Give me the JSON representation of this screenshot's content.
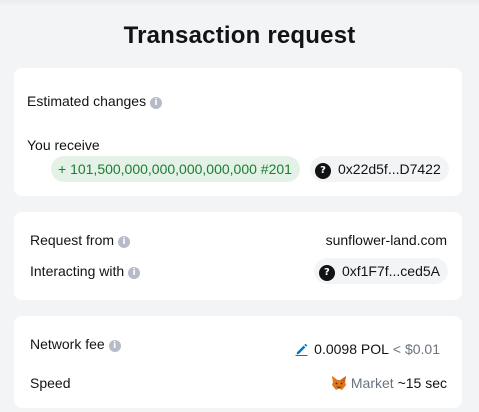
{
  "header": {
    "title": "Transaction request"
  },
  "estimated_changes": {
    "label": "Estimated changes",
    "you_receive_label": "You receive",
    "amount": "+ 101,500,000,000,000,000,000 #201",
    "contract_address": "0x22d5f...D7422"
  },
  "request": {
    "request_from_label": "Request from",
    "request_from_value": "sunflower-land.com",
    "interacting_with_label": "Interacting with",
    "interacting_with_value": "0xf1F7f...ced5A"
  },
  "network": {
    "fee_label": "Network fee",
    "fee_value": "0.0098 POL",
    "fee_fiat": "< $0.01",
    "speed_label": "Speed",
    "speed_value": "Market",
    "speed_time": "~15 sec"
  },
  "icons": {
    "info": "info-icon",
    "question": "question-icon",
    "edit": "pencil-icon",
    "fox": "fox-icon"
  },
  "colors": {
    "background": "#f2f4f6",
    "card": "#ffffff",
    "positive_text": "#1c7e33",
    "positive_bg": "#e4f1e6",
    "link_blue": "#0376c9"
  }
}
